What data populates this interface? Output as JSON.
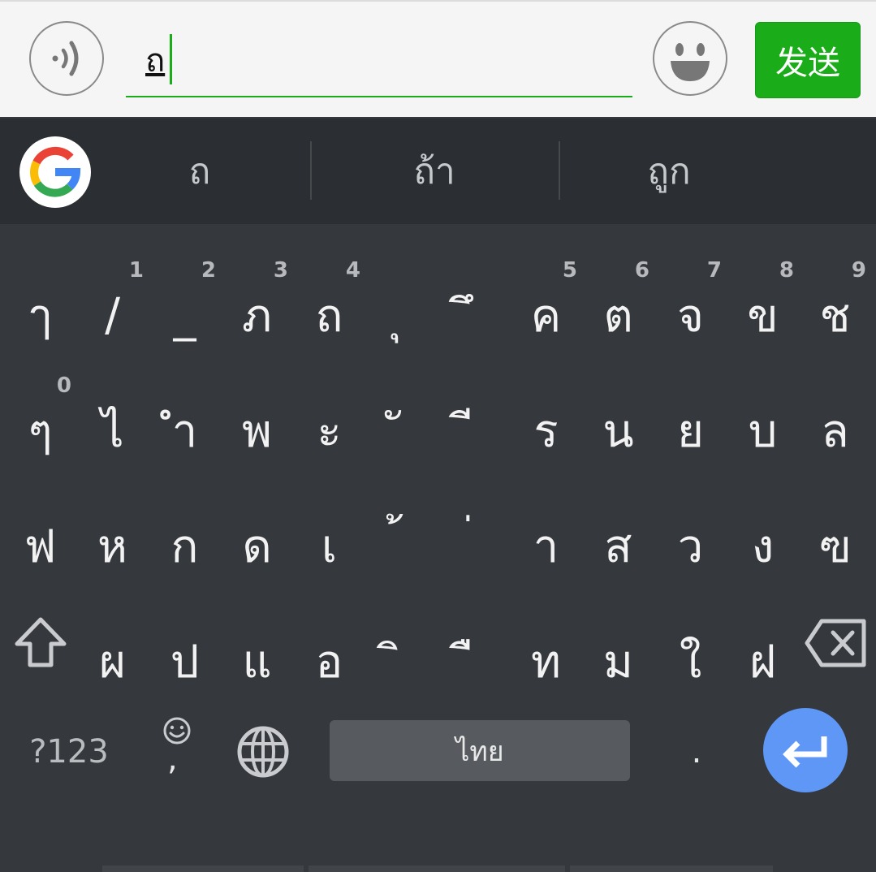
{
  "header": {
    "input_text": "ถ",
    "send_label": "发送",
    "voice_icon": "voice-wave-icon",
    "emoji_icon": "smiley-face-icon"
  },
  "suggestions": {
    "items": [
      "ถ",
      "ถ้า",
      "ถูก"
    ],
    "logo": "google-g-icon"
  },
  "keyboard": {
    "row1": [
      {
        "ch": "ๅ",
        "hint": ""
      },
      {
        "ch": "/",
        "hint": "1"
      },
      {
        "ch": "_",
        "hint": "2"
      },
      {
        "ch": "ภ",
        "hint": "3"
      },
      {
        "ch": "ถ",
        "hint": "4"
      },
      {
        "ch": "ุ",
        "hint": ""
      },
      {
        "ch": "ึ",
        "hint": ""
      },
      {
        "ch": "ค",
        "hint": "5"
      },
      {
        "ch": "ต",
        "hint": "6"
      },
      {
        "ch": "จ",
        "hint": "7"
      },
      {
        "ch": "ข",
        "hint": "8"
      },
      {
        "ch": "ช",
        "hint": "9"
      }
    ],
    "row2": [
      {
        "ch": "ๆ",
        "hint": "0"
      },
      {
        "ch": "ไ",
        "hint": ""
      },
      {
        "ch": "ำ",
        "hint": ""
      },
      {
        "ch": "พ",
        "hint": ""
      },
      {
        "ch": "ะ",
        "hint": ""
      },
      {
        "ch": "ั",
        "hint": ""
      },
      {
        "ch": "ี",
        "hint": ""
      },
      {
        "ch": "ร",
        "hint": ""
      },
      {
        "ch": "น",
        "hint": ""
      },
      {
        "ch": "ย",
        "hint": ""
      },
      {
        "ch": "บ",
        "hint": ""
      },
      {
        "ch": "ล",
        "hint": ""
      }
    ],
    "row3": [
      {
        "ch": "ฟ",
        "hint": ""
      },
      {
        "ch": "ห",
        "hint": ""
      },
      {
        "ch": "ก",
        "hint": ""
      },
      {
        "ch": "ด",
        "hint": ""
      },
      {
        "ch": "เ",
        "hint": ""
      },
      {
        "ch": "้",
        "hint": ""
      },
      {
        "ch": "่",
        "hint": ""
      },
      {
        "ch": "า",
        "hint": ""
      },
      {
        "ch": "ส",
        "hint": ""
      },
      {
        "ch": "ว",
        "hint": ""
      },
      {
        "ch": "ง",
        "hint": ""
      },
      {
        "ch": "ฃ",
        "hint": ""
      }
    ],
    "row4": [
      {
        "ch": "ผ",
        "hint": ""
      },
      {
        "ch": "ป",
        "hint": ""
      },
      {
        "ch": "แ",
        "hint": ""
      },
      {
        "ch": "อ",
        "hint": ""
      },
      {
        "ch": "ิ",
        "hint": ""
      },
      {
        "ch": "ื",
        "hint": ""
      },
      {
        "ch": "ท",
        "hint": ""
      },
      {
        "ch": "ม",
        "hint": ""
      },
      {
        "ch": "ใ",
        "hint": ""
      },
      {
        "ch": "ฝ",
        "hint": ""
      }
    ],
    "bottom": {
      "sym_label": "?123",
      "comma_label": ",",
      "space_label": "ไทย",
      "period_label": "."
    },
    "icons": {
      "shift": "shift-arrow-icon",
      "backspace": "backspace-icon",
      "globe": "globe-icon",
      "emoji": "smiley-icon",
      "enter": "enter-arrow-icon"
    },
    "colors": {
      "accent_green": "#1aad19",
      "enter_blue": "#5e97f6",
      "keyboard_bg": "#35393e"
    }
  }
}
